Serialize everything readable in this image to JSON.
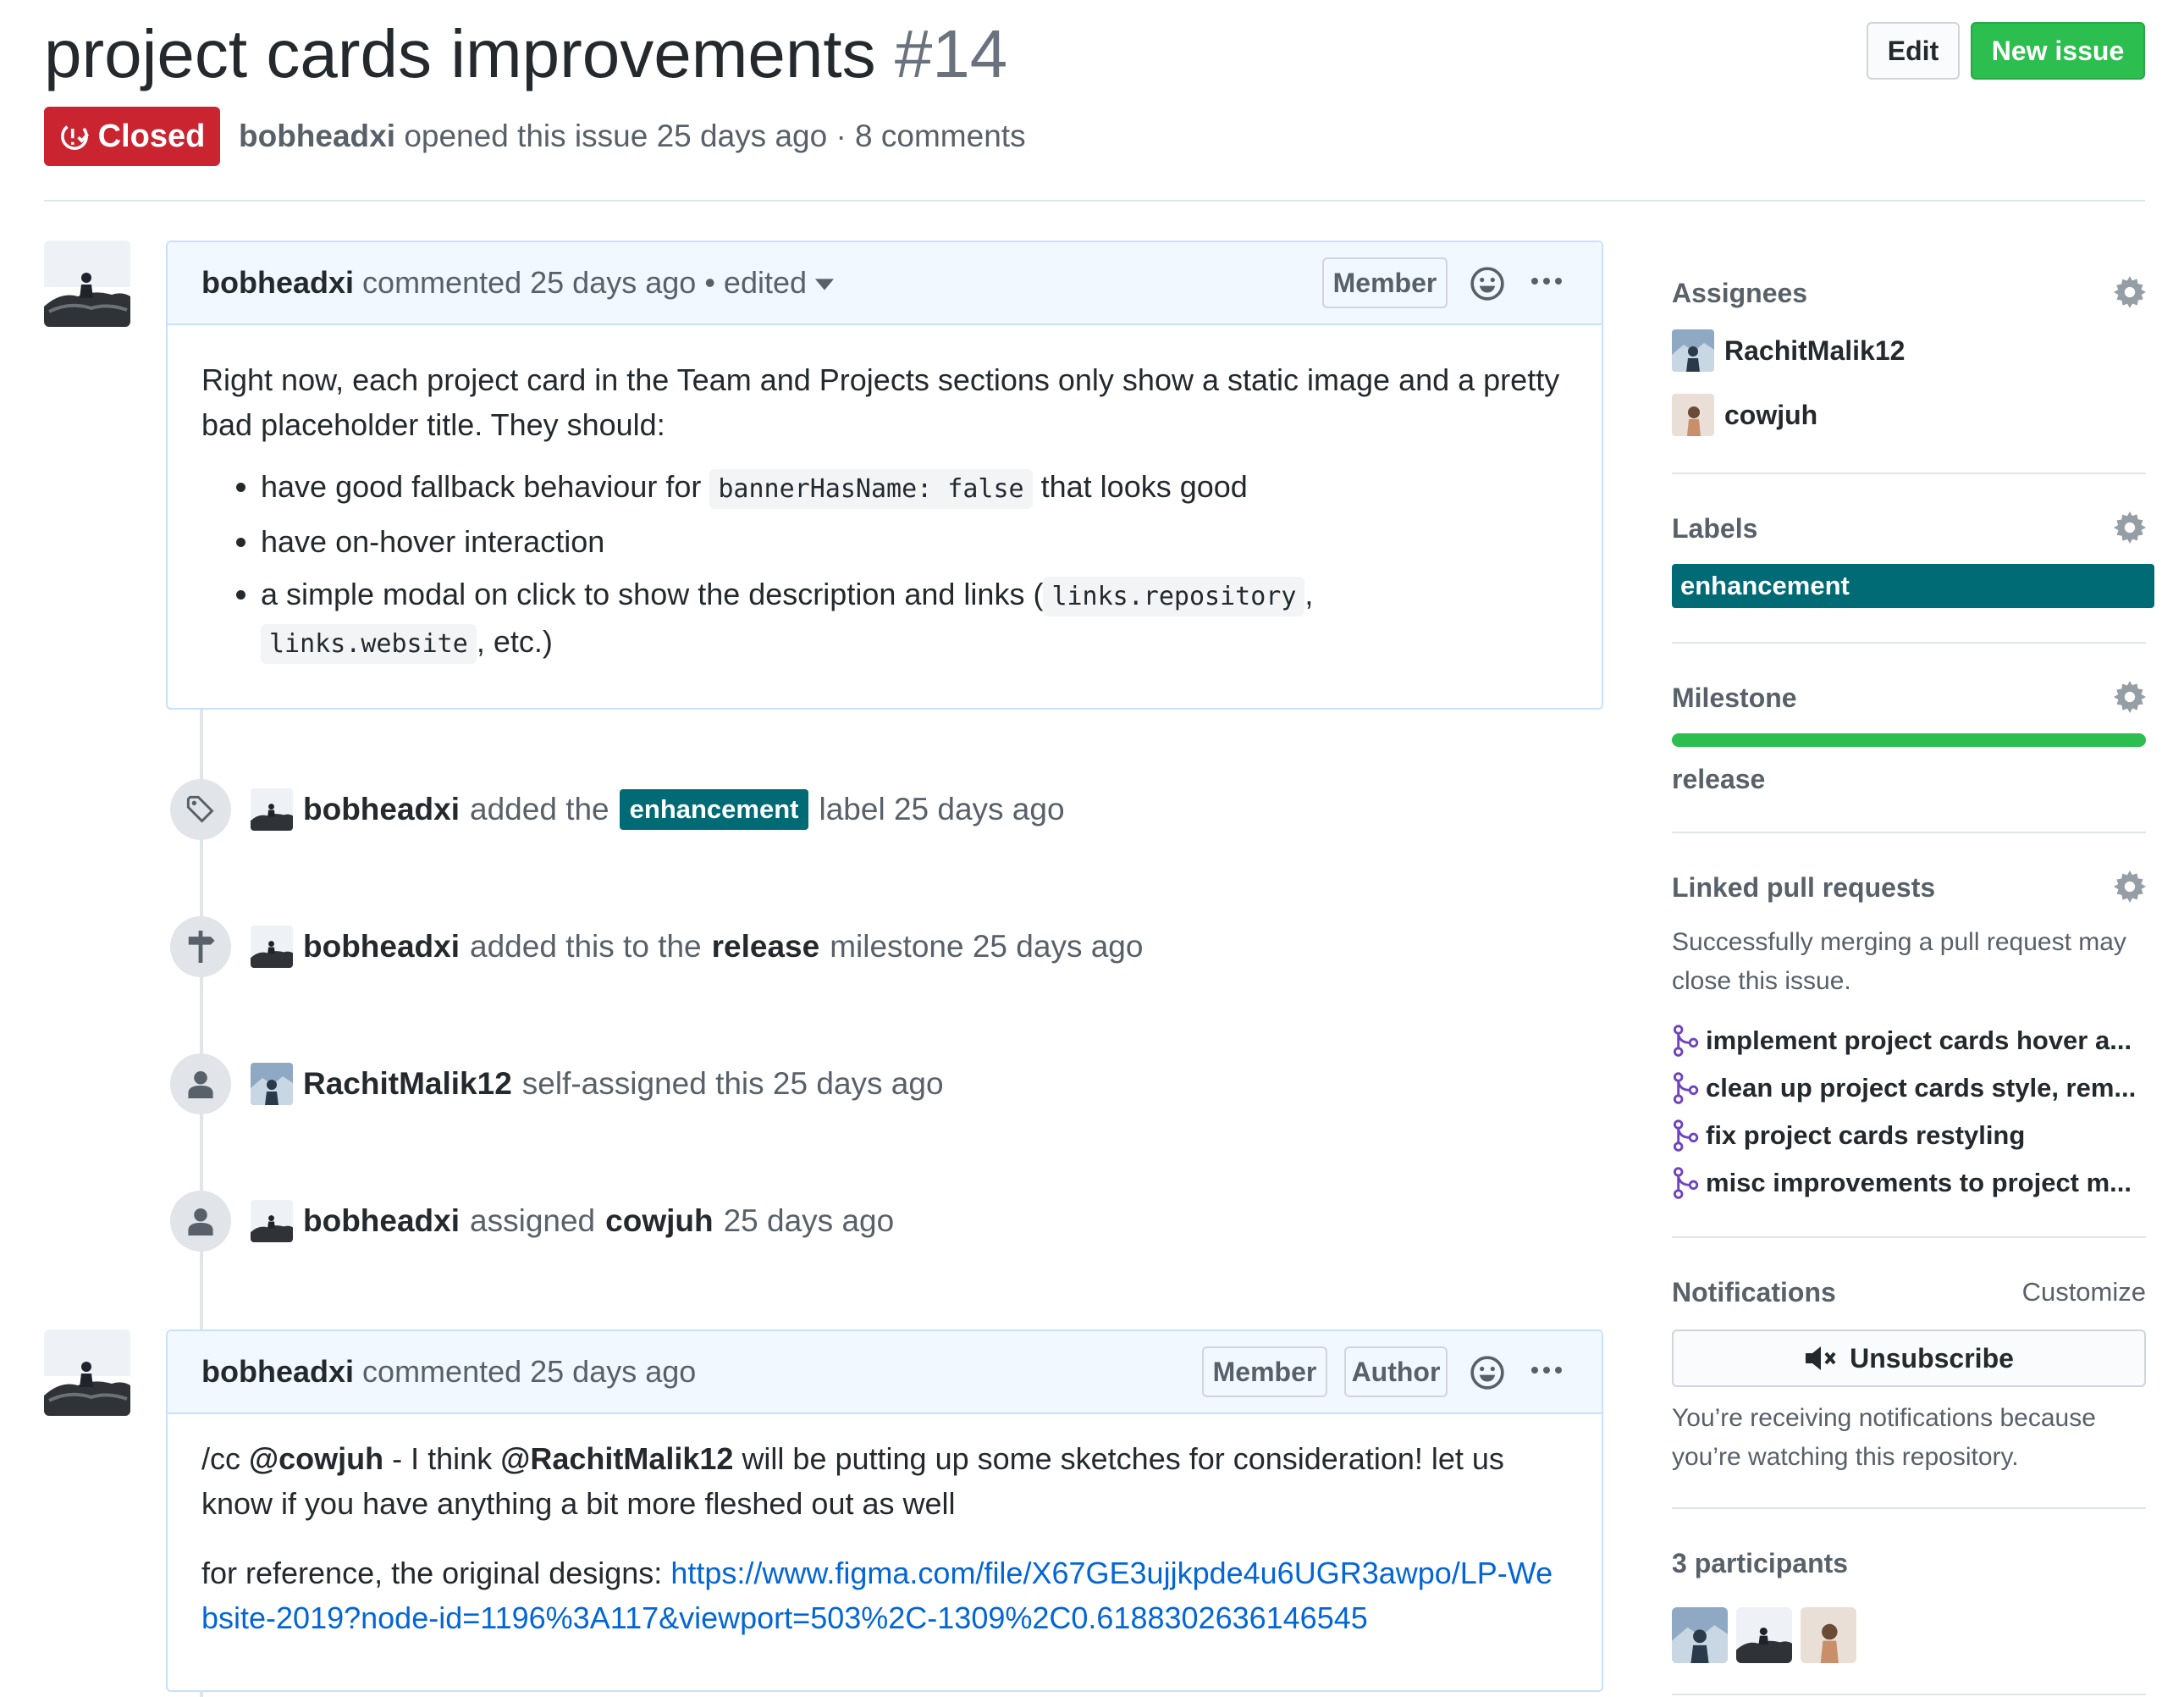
{
  "issue": {
    "title": "project cards improvements",
    "number": "#14",
    "state": "Closed",
    "author": "bobheadxi",
    "meta_text": "opened this issue 25 days ago · 8 comments"
  },
  "header_buttons": {
    "edit": "Edit",
    "new_issue": "New issue"
  },
  "comment1": {
    "author": "bobheadxi",
    "meta": "commented 25 days ago",
    "edited": "• edited",
    "badge_member": "Member",
    "body_p1": "Right now, each project card in the Team and Projects sections only show a static image and a pretty bad placeholder title. They should:",
    "li1_pre": "have good fallback behaviour for",
    "li1_code": "bannerHasName: false",
    "li1_post": "that looks good",
    "li2": "have on-hover interaction",
    "li3_pre": "a simple modal on click to show the description and links (",
    "li3_code1": "links.repository",
    "li3_mid": ",",
    "li3_code2": "links.website",
    "li3_post": ", etc.)"
  },
  "timeline": {
    "ev1": {
      "actor": "bobheadxi",
      "pre": "added the",
      "label": "enhancement",
      "post": "label 25 days ago"
    },
    "ev2": {
      "actor": "bobheadxi",
      "pre": "added this to the",
      "milestone": "release",
      "post": "milestone 25 days ago"
    },
    "ev3": {
      "actor": "RachitMalik12",
      "text": "self-assigned this 25 days ago"
    },
    "ev4": {
      "actor": "bobheadxi",
      "pre": "assigned",
      "target": "cowjuh",
      "post": "25 days ago"
    }
  },
  "comment2": {
    "author": "bobheadxi",
    "meta": "commented 25 days ago",
    "badge_member": "Member",
    "badge_author": "Author",
    "p1_a": "/cc",
    "p1_mention1": "@cowjuh",
    "p1_b": "- I think",
    "p1_mention2": "@RachitMalik12",
    "p1_c": "will be putting up some sketches for consideration! let us know if you have anything a bit more fleshed out as well",
    "p2_pre": "for reference, the original designs:",
    "p2_link": "https://www.figma.com/file/X67GE3ujjkpde4u6UGR3awpo/LP-Website-2019?node-id=1196%3A117&viewport=503%2C-1309%2C0.6188302636146545"
  },
  "sidebar": {
    "assignees": {
      "title": "Assignees",
      "users": [
        "RachitMalik12",
        "cowjuh"
      ]
    },
    "labels": {
      "title": "Labels",
      "items": [
        "enhancement"
      ]
    },
    "milestone": {
      "title": "Milestone",
      "name": "release",
      "progress_fraction": 1.0
    },
    "linked_prs": {
      "title": "Linked pull requests",
      "help": "Successfully merging a pull request may close this issue.",
      "items": [
        "implement project cards hover a...",
        "clean up project cards style, rem...",
        "fix project cards restyling",
        "misc improvements to project m..."
      ]
    },
    "notifications": {
      "title": "Notifications",
      "customize": "Customize",
      "button": "Unsubscribe",
      "reason": "You’re receiving notifications because you’re watching this repository."
    },
    "participants": {
      "title": "3 participants"
    }
  },
  "colors": {
    "closed": "#cb2431",
    "primary_button": "#2cbe4e",
    "label_enhancement": "#006b75",
    "link": "#0366d6",
    "pr_icon": "#6f42c1"
  }
}
